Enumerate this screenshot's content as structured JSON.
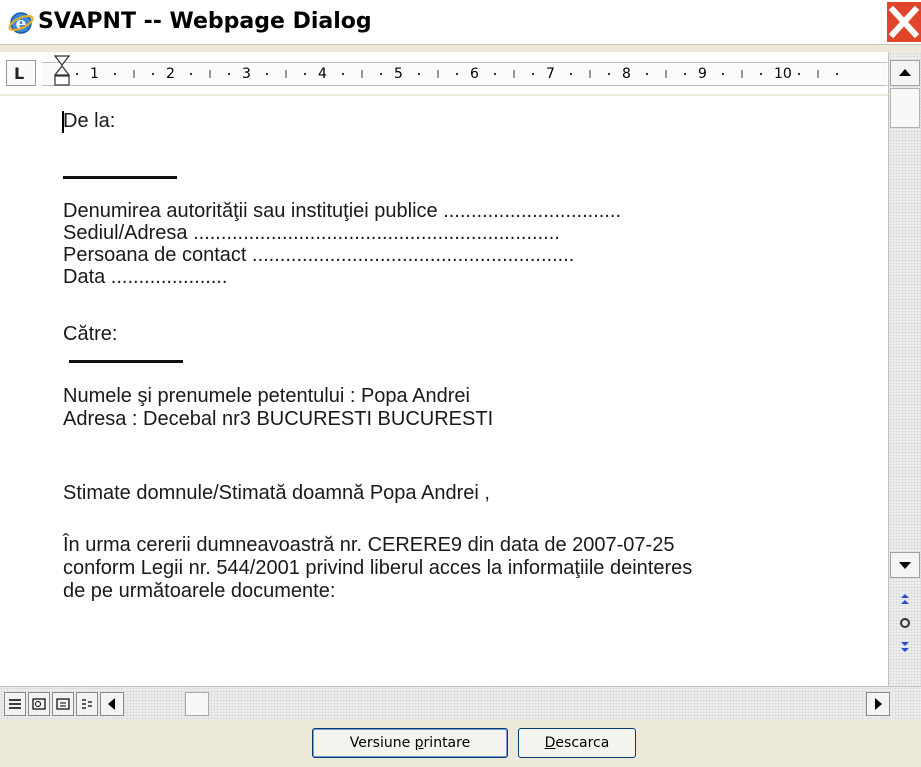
{
  "window": {
    "title": "SVAPNT -- Webpage Dialog",
    "title_icon": "internet-explorer-icon",
    "close_icon": "close-icon"
  },
  "ruler": {
    "corner_label": "L",
    "numbers": [
      "1",
      "2",
      "3",
      "4",
      "5",
      "6",
      "7",
      "8",
      "9",
      "10"
    ]
  },
  "document": {
    "from_label": "De la:",
    "authority_line": "Denumirea autorităţii sau instituţiei publice ................................",
    "address_line": "Sediul/Adresa ..................................................................",
    "contact_line": "Persoana de contact ..........................................................",
    "date_line": "Data .....................",
    "to_label": "Către:",
    "petitioner_line": "Numele şi prenumele petentului :   Popa Andrei",
    "petitioner_address_line": "Adresa  : Decebal nr3 BUCURESTI BUCURESTI",
    "salutation_line": "Stimate domnule/Stimată doamnă  Popa Andrei ,",
    "body_line_1": "În urma cererii dumneavoastră nr. CERERE9  din data de 2007-07-25",
    "body_line_2": "conform Legii nr. 544/2001 privind liberul acces la informaţiile deinteres",
    "body_line_3": "de pe următoarele documente:"
  },
  "buttons": {
    "print_prefix": "Versiune ",
    "print_underlined": "p",
    "print_suffix": "rintare",
    "download_underlined": "D",
    "download_suffix": "escarca"
  },
  "colors": {
    "dialog_bg": "#ece9d8",
    "close_red": "#e0452a",
    "button_border": "#003c74",
    "nav_blue": "#2a4cc7"
  }
}
